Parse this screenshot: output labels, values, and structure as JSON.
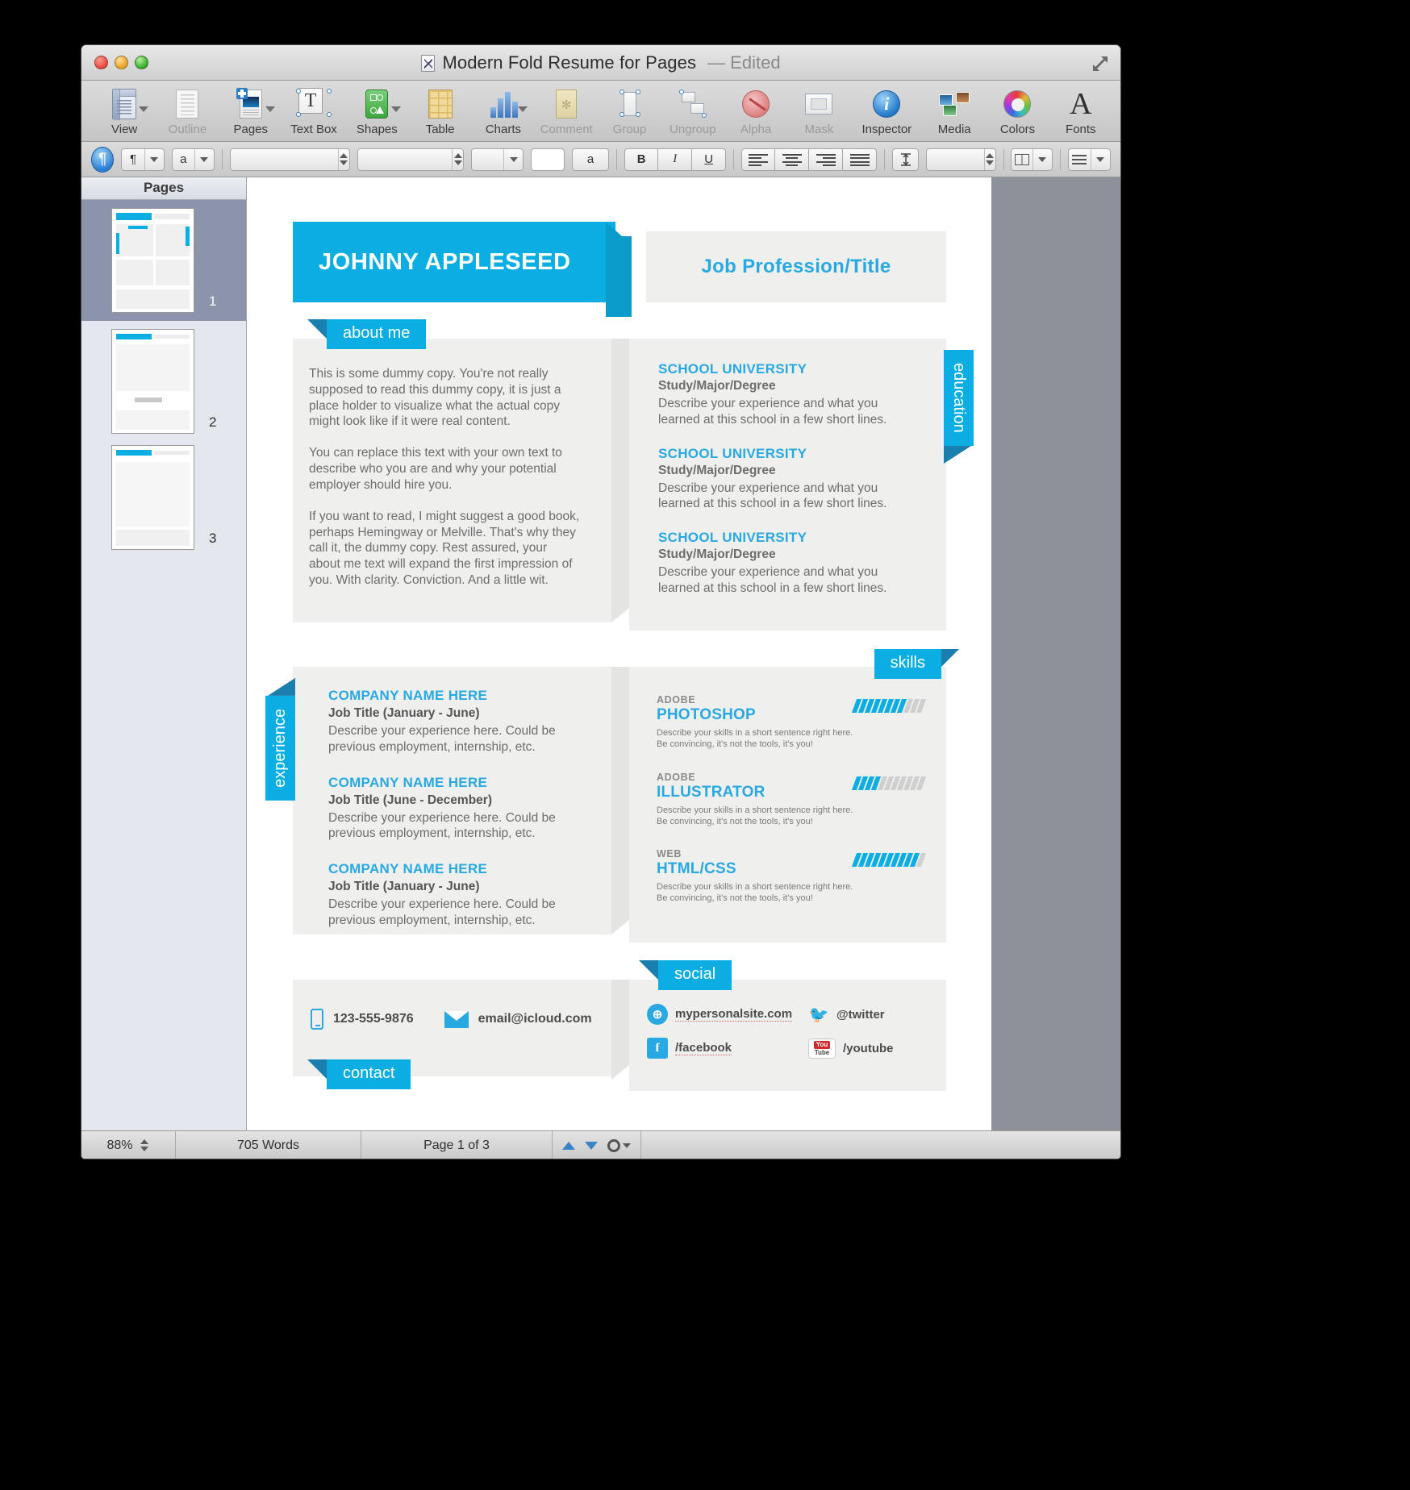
{
  "window": {
    "title": "Modern Fold Resume for Pages",
    "edited_suffix": "— Edited",
    "doc_icon": "pages-document-icon"
  },
  "toolbar": {
    "items": [
      {
        "label": "View",
        "icon": "view-icon",
        "dimmed": false,
        "caret": true
      },
      {
        "label": "Outline",
        "icon": "outline-icon",
        "dimmed": true,
        "caret": false
      },
      {
        "label": "Pages",
        "icon": "pages-icon",
        "dimmed": false,
        "caret": true
      },
      {
        "label": "Text Box",
        "icon": "text-box-icon",
        "dimmed": false,
        "caret": false
      },
      {
        "label": "Shapes",
        "icon": "shapes-icon",
        "dimmed": false,
        "caret": true
      },
      {
        "label": "Table",
        "icon": "table-icon",
        "dimmed": false,
        "caret": false
      },
      {
        "label": "Charts",
        "icon": "charts-icon",
        "dimmed": false,
        "caret": true
      },
      {
        "label": "Comment",
        "icon": "comment-icon",
        "dimmed": true,
        "caret": false
      },
      {
        "label": "Group",
        "icon": "group-icon",
        "dimmed": true,
        "caret": false
      },
      {
        "label": "Ungroup",
        "icon": "ungroup-icon",
        "dimmed": true,
        "caret": false
      },
      {
        "label": "Alpha",
        "icon": "alpha-icon",
        "dimmed": true,
        "caret": false
      },
      {
        "label": "Mask",
        "icon": "mask-icon",
        "dimmed": true,
        "caret": false
      },
      {
        "label": "Inspector",
        "icon": "inspector-icon",
        "dimmed": false,
        "caret": false
      },
      {
        "label": "Media",
        "icon": "media-icon",
        "dimmed": false,
        "caret": false
      },
      {
        "label": "Colors",
        "icon": "colors-icon",
        "dimmed": false,
        "caret": false
      },
      {
        "label": "Fonts",
        "icon": "fonts-icon",
        "dimmed": false,
        "caret": false
      }
    ]
  },
  "formatbar": {
    "paragraph_glyph": "¶",
    "char_glyph": "a",
    "font_family_value": "",
    "font_style_value": "",
    "font_size_value": "",
    "text_color_swatch": "a",
    "bold": "B",
    "italic": "I",
    "underline": "U"
  },
  "sidebar": {
    "title": "Pages",
    "thumbnails": [
      {
        "number": "1",
        "selected": true
      },
      {
        "number": "2",
        "selected": false
      },
      {
        "number": "3",
        "selected": false
      }
    ]
  },
  "statusbar": {
    "zoom": "88%",
    "words": "705 Words",
    "page": "Page 1 of 3",
    "nav_up": "previous-page-icon",
    "nav_down": "next-page-icon",
    "gear": "settings-gear-icon"
  },
  "resume": {
    "name": "JOHNNY APPLESEED",
    "job_title": "Job Profession/Title",
    "about": {
      "ribbon": "about me",
      "paragraphs": [
        "This is some dummy copy. You're not really supposed to read this dummy copy, it is just a place holder to visualize what the actual copy might look like if it were real content.",
        "You can replace this text with your own text to describe who you are and why your potential employer should hire you.",
        "If you want to read, I might suggest a good book, perhaps Hemingway or Melville. That's why they call it, the dummy copy. Rest assured, your about me text will expand the first impression of you. With clarity. Conviction. And a little wit."
      ]
    },
    "education": {
      "tab": "education",
      "items": [
        {
          "school": "SCHOOL UNIVERSITY",
          "degree": "Study/Major/Degree",
          "desc": "Describe your experience and what you learned at this school in a few short lines."
        },
        {
          "school": "SCHOOL UNIVERSITY",
          "degree": "Study/Major/Degree",
          "desc": "Describe your experience and what you learned at this school in a few short lines."
        },
        {
          "school": "SCHOOL UNIVERSITY",
          "degree": "Study/Major/Degree",
          "desc": "Describe your experience and what you learned at this school in a few short lines."
        }
      ]
    },
    "experience": {
      "tab": "experience",
      "items": [
        {
          "company": "COMPANY NAME HERE",
          "title": "Job Title (January - June)",
          "desc": "Describe your experience here. Could be previous employment, internship, etc."
        },
        {
          "company": "COMPANY NAME HERE",
          "title": "Job Title (June - December)",
          "desc": "Describe your experience here. Could be previous employment, internship, etc."
        },
        {
          "company": "COMPANY NAME HERE",
          "title": "Job Title (January - June)",
          "desc": "Describe your experience here. Could be previous employment, internship, etc."
        }
      ]
    },
    "skills": {
      "ribbon": "skills",
      "items": [
        {
          "category": "ADOBE",
          "name": "PHOTOSHOP",
          "desc": "Describe your skills in a short sentence right here. Be convincing, it's not the tools, it's you!",
          "filled": 8,
          "total": 11
        },
        {
          "category": "ADOBE",
          "name": "ILLUSTRATOR",
          "desc": "Describe your skills in a short sentence right here. Be convincing, it's not the tools, it's you!",
          "filled": 4,
          "total": 11
        },
        {
          "category": "WEB",
          "name": "HTML/CSS",
          "desc": "Describe your skills in a short sentence right here. Be convincing, it's not the tools, it's you!",
          "filled": 10,
          "total": 11
        }
      ]
    },
    "contact": {
      "ribbon": "contact",
      "phone": "123-555-9876",
      "phone_icon": "phone-icon",
      "email": "email@icloud.com",
      "email_icon": "envelope-icon"
    },
    "social": {
      "ribbon": "social",
      "items": [
        {
          "label": "mypersonalsite.com",
          "icon": "globe-icon",
          "link": true
        },
        {
          "label": "@twitter",
          "icon": "twitter-icon",
          "link": false
        },
        {
          "label": "/facebook",
          "icon": "facebook-icon",
          "link": true
        },
        {
          "label": "/youtube",
          "icon": "youtube-icon",
          "link": false
        }
      ]
    }
  },
  "colors": {
    "accent_blue": "#0aaee3",
    "accent_blue_dark": "#1a7fae",
    "panel_grey": "#efefee",
    "text_grey": "#6d6d6d",
    "heading_blue": "#29a9e1"
  }
}
